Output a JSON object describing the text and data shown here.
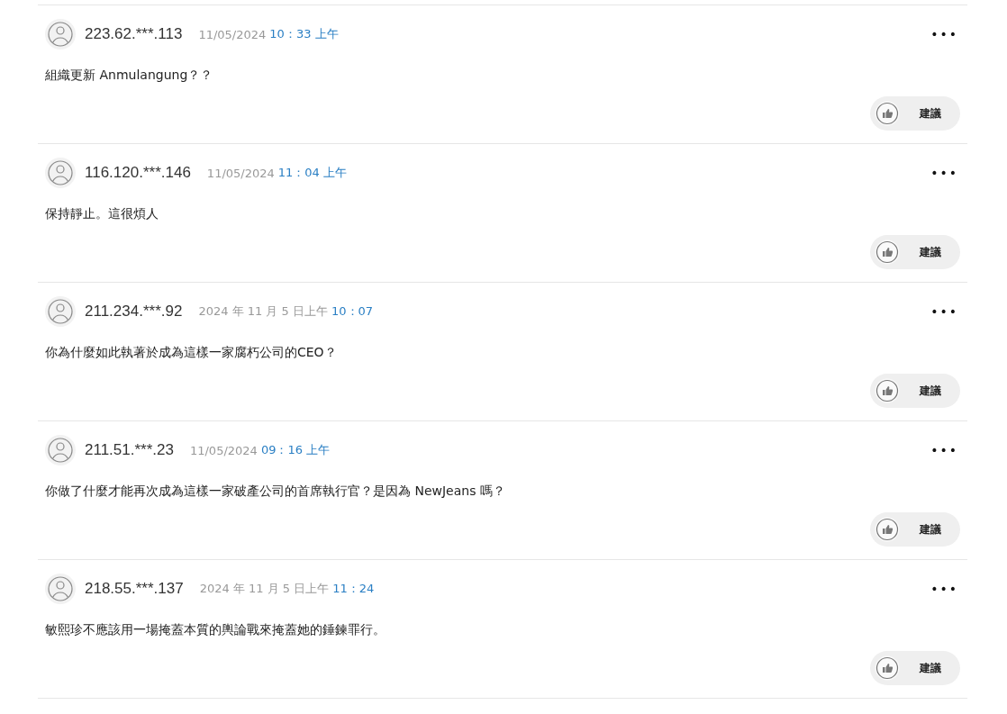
{
  "comments": [
    {
      "user": "223.62.***.113",
      "date": "11/05/2024",
      "time": "10：33 上午",
      "text": "組織更新 Anmulangung？？",
      "more": "•••",
      "action": "建議"
    },
    {
      "user": "116.120.***.146",
      "date": "11/05/2024",
      "time": "11：04 上午",
      "text": "保持靜止。這很煩人",
      "more": "•••",
      "action": "建議"
    },
    {
      "user": "211.234.***.92",
      "date": "2024 年 11 月 5 日上午",
      "time": "10：07",
      "text": "你為什麼如此執著於成為這樣一家腐朽公司的CEO？",
      "more": "•••",
      "action": "建議"
    },
    {
      "user": "211.51.***.23",
      "date": "11/05/2024",
      "time": "09：16 上午",
      "text": "你做了什麼才能再次成為這樣一家破產公司的首席執行官？是因為 NewJeans 嗎？",
      "more": "•••",
      "action": "建議"
    },
    {
      "user": "218.55.***.137",
      "date": "2024 年 11 月 5 日上午",
      "time": "11：24",
      "text": "敏熙珍不應該用一場掩蓋本質的輿論戰來掩蓋她的錘鍊罪行。",
      "more": "•••",
      "action": "建議"
    }
  ]
}
